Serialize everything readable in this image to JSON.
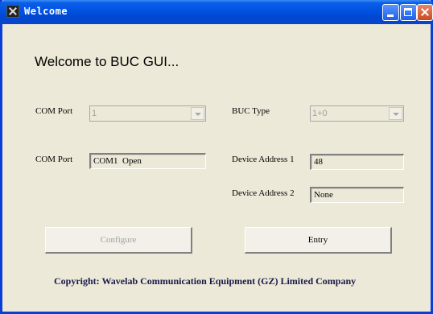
{
  "window": {
    "title": "Welcome",
    "icon": "app-icon",
    "controls": {
      "minimize": "minimize-icon",
      "maximize": "maximize-icon",
      "close": "close-icon"
    }
  },
  "heading": "Welcome to BUC GUI...",
  "com_port": {
    "label": "COM Port",
    "selected": "1"
  },
  "buc_type": {
    "label": "BUC Type",
    "selected": "1+0"
  },
  "com_status": {
    "label": "COM Port",
    "value": "COM1  Open"
  },
  "device_address_1": {
    "label": "Device Address 1",
    "value": "48"
  },
  "device_address_2": {
    "label": "Device Address 2",
    "value": "None"
  },
  "buttons": {
    "configure": "Configure",
    "entry": "Entry"
  },
  "copyright": "Copyright: Wavelab Communication Equipment (GZ) Limited Company",
  "colors": {
    "titlebar": "#0053e1",
    "window_bg": "#ece9d8",
    "close_button": "#c94a22"
  }
}
